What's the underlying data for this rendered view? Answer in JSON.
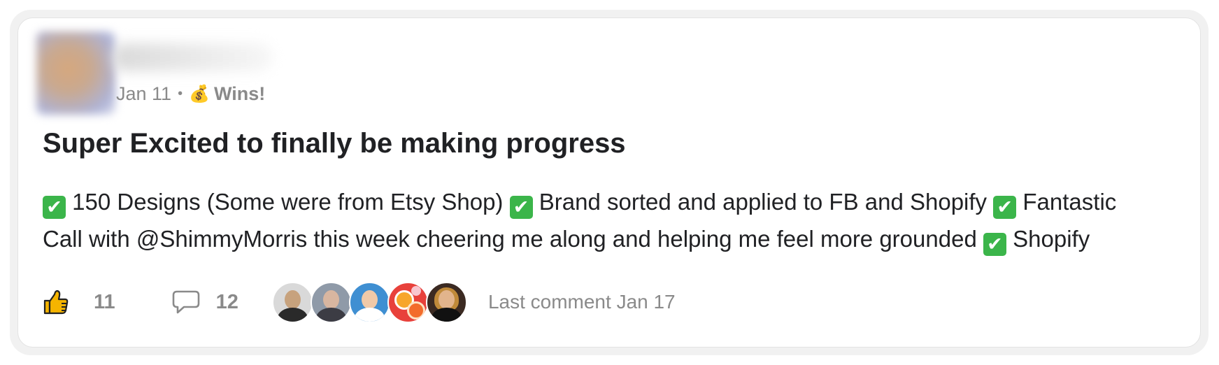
{
  "post": {
    "date": "Jan 11",
    "separator": "•",
    "category_icon": "💰",
    "category_icon_name": "money-bag-icon",
    "category": "Wins!",
    "title": "Super Excited to finally be making progress",
    "check_glyph": "✔",
    "body": {
      "line1_seg1": "150 Designs (Some were from Etsy Shop)",
      "line1_seg2": "Brand sorted and applied to FB and Shopify",
      "line1_seg3": "Fantastic",
      "line2_seg1": "Call with @ShimmyMorris this week cheering me along and helping me feel more grounded",
      "line2_seg2": "Shopify"
    }
  },
  "footer": {
    "like_icon": "thumbs-up-icon",
    "likes": "11",
    "comment_icon": "comment-bubble-icon",
    "comments": "12",
    "commenter_count": 5,
    "last_comment": "Last comment Jan 17"
  },
  "colors": {
    "title": "#202124",
    "muted": "#8a8a8a",
    "check": "#3bb54a",
    "thumb": "#f5b400"
  }
}
